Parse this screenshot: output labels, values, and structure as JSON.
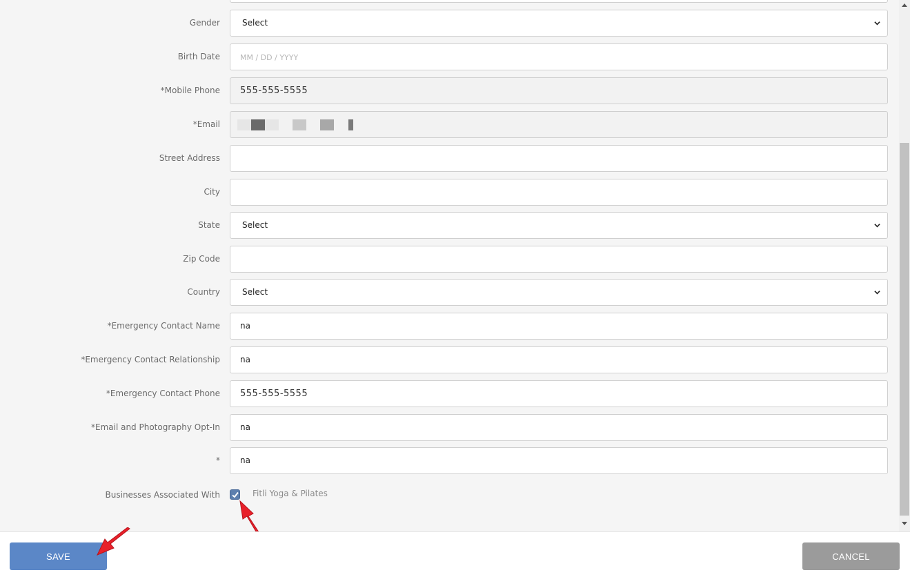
{
  "form": {
    "fields": [
      {
        "label": "Gender",
        "type": "select",
        "value": "Select"
      },
      {
        "label": "Birth Date",
        "type": "input",
        "value": "",
        "placeholder": "MM / DD / YYYY"
      },
      {
        "label": "*Mobile Phone",
        "type": "readonly",
        "value": "555-555-5555"
      },
      {
        "label": "*Email",
        "type": "readonly-redacted",
        "value": ""
      },
      {
        "label": "Street Address",
        "type": "input",
        "value": ""
      },
      {
        "label": "City",
        "type": "input",
        "value": ""
      },
      {
        "label": "State",
        "type": "select",
        "value": "Select"
      },
      {
        "label": "Zip Code",
        "type": "input",
        "value": ""
      },
      {
        "label": "Country",
        "type": "select",
        "value": "Select"
      },
      {
        "label": "*Emergency Contact Name",
        "type": "input",
        "value": "na"
      },
      {
        "label": "*Emergency Contact Relationship",
        "type": "input",
        "value": "na"
      },
      {
        "label": "*Emergency Contact Phone",
        "type": "input",
        "value": "555-555-5555"
      },
      {
        "label": "*Email and Photography Opt-In",
        "type": "input",
        "value": "na"
      },
      {
        "label": "*",
        "type": "input",
        "value": "na"
      }
    ],
    "businesses": {
      "label": "Businesses Associated With",
      "option_label": "Fitli Yoga & Pilates",
      "checked": true
    }
  },
  "footer": {
    "save_label": "SAVE",
    "cancel_label": "CANCEL"
  },
  "colors": {
    "save_button": "#5b87c7",
    "cancel_button": "#9b9b9b",
    "checkbox": "#5d7fae",
    "annotation_arrow": "#e8202a"
  }
}
